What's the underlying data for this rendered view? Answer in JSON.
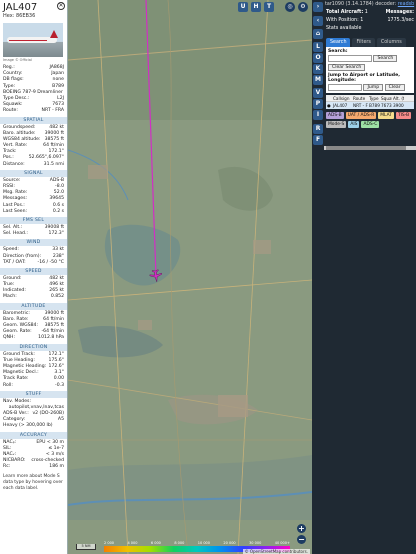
{
  "aircraft": {
    "callsign": "JAL407",
    "hex_line": "Hex: 86EB36",
    "photo_credit": "Image © Official"
  },
  "info_rows": [
    {
      "k": "Reg.:",
      "v": "JA868J"
    },
    {
      "k": "Country:",
      "v": "Japan"
    },
    {
      "k": "DB flags:",
      "v": "none"
    },
    {
      "k": "Type:",
      "v": "B789"
    },
    {
      "k": "BOEING 787-9 Dreamliner",
      "v": ""
    },
    {
      "k": "Type Desc.:",
      "v": "L2J"
    },
    {
      "k": "Squawk:",
      "v": "7673"
    },
    {
      "k": "Route:",
      "v": "NRT - FRA"
    }
  ],
  "sections": [
    {
      "title": "SPATIAL",
      "rows": [
        {
          "k": "Groundspeed:",
          "v": "482 kt"
        },
        {
          "k": "Baro. altitude:",
          "v": "39000 ft"
        },
        {
          "k": "WGS84 altitude:",
          "v": "38575 ft"
        },
        {
          "k": "Vert. Rate:",
          "v": "64 ft/min"
        },
        {
          "k": "Track:",
          "v": "172.1°"
        },
        {
          "k": "Pos.:",
          "v": "52.665°,6.097°"
        },
        {
          "k": "Distance:",
          "v": "31.5 nmi"
        }
      ]
    },
    {
      "title": "SIGNAL",
      "rows": [
        {
          "k": "Source:",
          "v": "ADS-B"
        },
        {
          "k": "RSSI:",
          "v": "-8.0"
        },
        {
          "k": "Msg. Rate:",
          "v": "52.0"
        },
        {
          "k": "Messages:",
          "v": "39645"
        },
        {
          "k": "Last Pos.:",
          "v": "0.6 s"
        },
        {
          "k": "Last Seen:",
          "v": "0.2 s"
        }
      ]
    },
    {
      "title": "FMS SEL",
      "rows": [
        {
          "k": "Sel. Alt.:",
          "v": "39008 ft"
        },
        {
          "k": "Sel. Head.:",
          "v": "172.3°"
        }
      ]
    },
    {
      "title": "WIND",
      "rows": [
        {
          "k": "Speed:",
          "v": "33 kt"
        },
        {
          "k": "Direction (from):",
          "v": "238°"
        },
        {
          "k": "TAT / OAT:",
          "v": "-16 / -50 °C"
        }
      ]
    },
    {
      "title": "SPEED",
      "rows": [
        {
          "k": "Ground:",
          "v": "482 kt"
        },
        {
          "k": "True:",
          "v": "496 kt"
        },
        {
          "k": "Indicated:",
          "v": "265 kt"
        },
        {
          "k": "Mach:",
          "v": "0.852"
        }
      ]
    },
    {
      "title": "ALTITUDE",
      "rows": [
        {
          "k": "Barometric:",
          "v": "39000 ft"
        },
        {
          "k": "Baro. Rate:",
          "v": "64 ft/min"
        },
        {
          "k": "Geom. WGS84:",
          "v": "38575 ft"
        },
        {
          "k": "Geom. Rate:",
          "v": "-64 ft/min"
        },
        {
          "k": "QNH:",
          "v": "1012.8 hPa"
        }
      ]
    },
    {
      "title": "DIRECTION",
      "rows": [
        {
          "k": "Ground Track:",
          "v": "172.1°"
        },
        {
          "k": "True Heading:",
          "v": "175.6°"
        },
        {
          "k": "Magnetic Heading:",
          "v": "172.6°"
        },
        {
          "k": "Magnetic Decl.:",
          "v": "3.1°"
        },
        {
          "k": "Track Rate:",
          "v": "0.00"
        },
        {
          "k": "Roll:",
          "v": "-0.3"
        }
      ]
    },
    {
      "title": "STUFF",
      "rows": [
        {
          "k": "Nav. Modes:",
          "v": ""
        },
        {
          "k": "",
          "v": "autopilot,vnav,lnav,tcas"
        },
        {
          "k": "ADS-B Ver.:",
          "v": "v2 (DO-260B)"
        },
        {
          "k": "Category:",
          "v": "A5"
        },
        {
          "k": "Heavy (> 300,000 lb)",
          "v": ""
        }
      ]
    },
    {
      "title": "ACCURACY",
      "rows": [
        {
          "k": "NACₚ:",
          "v": "EPU < 30 m"
        },
        {
          "k": "SIL:",
          "v": "≤ 1e-7"
        },
        {
          "k": "NACᵥ:",
          "v": "< 3 m/s"
        },
        {
          "k": "NICBARO:",
          "v": "cross-checked"
        },
        {
          "k": "Rc:",
          "v": "186 m"
        }
      ]
    }
  ],
  "footer_note": "Learn more about Mode S data type by hovering over each data label.",
  "map": {
    "top_buttons": [
      "U",
      "H",
      "T"
    ],
    "alt_labels": [
      "2 000",
      "4 000",
      "6 000",
      "8 000",
      "10 000",
      "20 000",
      "30 000",
      "40 000+"
    ],
    "scale_label": "5 NM",
    "attribution": "© OpenStreetMap contributors."
  },
  "side_buttons": [
    "L",
    "O",
    "K",
    "M",
    "V",
    "P",
    "I",
    "R",
    "F"
  ],
  "sidebar": {
    "version_text": "tar1090 (3.14.1784) decoder:",
    "version_link": "readsb",
    "total_label": "Total Aircraft:",
    "total_value": "1",
    "messages_label": "Messages:",
    "messages_value": "1775.3/sec",
    "with_pos": "With Position: 1",
    "stats": "Stats available",
    "tabs": [
      "Search",
      "Filters",
      "Columns"
    ],
    "search_label": "Search:",
    "search_btn": "Search",
    "clear_btn": "Clear Search",
    "jump_label": "Jump to Airport or Latitude, Longitude:",
    "jump_btn": "Jump",
    "clear2_btn": "Clear",
    "table_head": [
      "",
      "Callsign",
      "Route",
      "Type",
      "Squawk",
      "Alt. (ft)"
    ],
    "table_row": [
      "",
      "JAL407",
      "NRT - FRA",
      "B789",
      "7673",
      "39000"
    ],
    "badges": [
      {
        "label": "ADS-B",
        "color": "#b4a0d8"
      },
      {
        "label": "UAT / ADS-R",
        "color": "#f5a96e"
      },
      {
        "label": "MLAT",
        "color": "#f6dc8c"
      },
      {
        "label": "TIS-B",
        "color": "#f58a8a"
      },
      {
        "label": "Mode-S",
        "color": "#bcbcbc"
      },
      {
        "label": "AIS",
        "color": "#9ccfe8"
      },
      {
        "label": "ADS-C",
        "color": "#9de0a5"
      }
    ]
  }
}
